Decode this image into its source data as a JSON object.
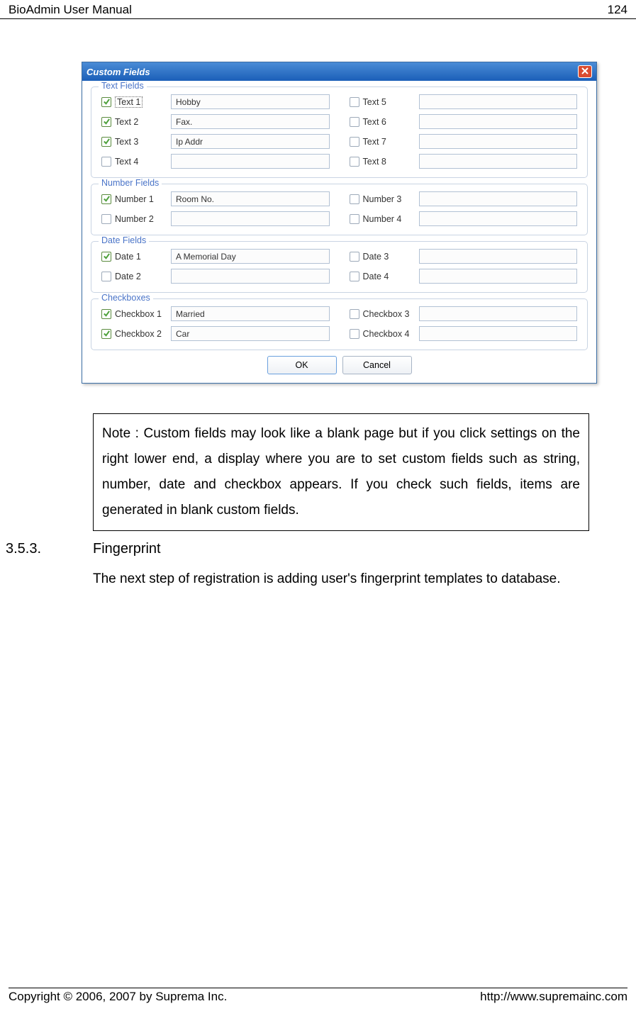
{
  "header": {
    "title": "BioAdmin  User  Manual",
    "page": "124"
  },
  "dialog": {
    "title": "Custom Fields",
    "groups": {
      "text": {
        "legend": "Text Fields",
        "rows": [
          {
            "checked": true,
            "label": "Text 1",
            "value": "Hobby",
            "selected": true
          },
          {
            "checked": true,
            "label": "Text 2",
            "value": "Fax."
          },
          {
            "checked": true,
            "label": "Text 3",
            "value": "Ip Addr"
          },
          {
            "checked": false,
            "label": "Text 4",
            "value": ""
          },
          {
            "checked": false,
            "label": "Text 5",
            "value": ""
          },
          {
            "checked": false,
            "label": "Text 6",
            "value": ""
          },
          {
            "checked": false,
            "label": "Text 7",
            "value": ""
          },
          {
            "checked": false,
            "label": "Text 8",
            "value": ""
          }
        ]
      },
      "number": {
        "legend": "Number Fields",
        "rows": [
          {
            "checked": true,
            "label": "Number 1",
            "value": "Room No."
          },
          {
            "checked": false,
            "label": "Number 2",
            "value": ""
          },
          {
            "checked": false,
            "label": "Number 3",
            "value": ""
          },
          {
            "checked": false,
            "label": "Number 4",
            "value": ""
          }
        ]
      },
      "date": {
        "legend": "Date Fields",
        "rows": [
          {
            "checked": true,
            "label": "Date 1",
            "value": "A Memorial Day"
          },
          {
            "checked": false,
            "label": "Date 2",
            "value": ""
          },
          {
            "checked": false,
            "label": "Date 3",
            "value": ""
          },
          {
            "checked": false,
            "label": "Date 4",
            "value": ""
          }
        ]
      },
      "checkbox": {
        "legend": "Checkboxes",
        "rows": [
          {
            "checked": true,
            "label": "Checkbox 1",
            "value": "Married"
          },
          {
            "checked": true,
            "label": "Checkbox 2",
            "value": "Car"
          },
          {
            "checked": false,
            "label": "Checkbox 3",
            "value": ""
          },
          {
            "checked": false,
            "label": "Checkbox 4",
            "value": ""
          }
        ]
      }
    },
    "buttons": {
      "ok": "OK",
      "cancel": "Cancel"
    }
  },
  "note": "Note : Custom fields may look like a blank page but if you click settings on the right lower end, a display where you are to set custom fields such as string, number, date and checkbox appears. If you check such fields, items are generated in blank custom fields.",
  "section": {
    "num": "3.5.3.",
    "title": "Fingerprint"
  },
  "body": "The next step of registration is adding user's fingerprint templates to database.",
  "footer": {
    "copyright": "Copyright © 2006, 2007 by Suprema Inc.",
    "url": "http://www.supremainc.com"
  }
}
